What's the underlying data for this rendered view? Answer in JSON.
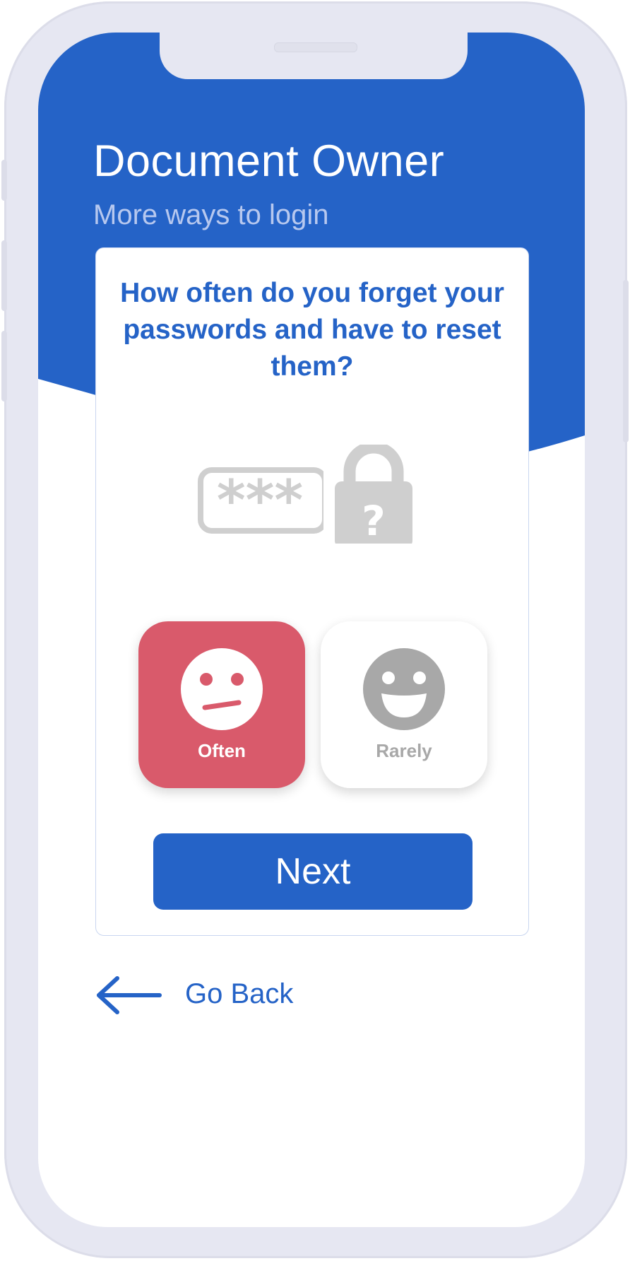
{
  "app": {
    "title": "Document Owner",
    "subtitle": "More ways to login"
  },
  "question": {
    "text": "How often do you forget your passwords and have to reset them?"
  },
  "illustration": {
    "masked_text": "***",
    "lock_symbol": "?",
    "icon": "password-lock-question-icon"
  },
  "choices": [
    {
      "label": "Often",
      "icon": "neutral-face-icon",
      "selected": true
    },
    {
      "label": "Rarely",
      "icon": "smiling-face-icon",
      "selected": false
    }
  ],
  "actions": {
    "next_label": "Next",
    "back_label": "Go Back",
    "back_icon": "arrow-left-icon"
  },
  "colors": {
    "primary": "#2563c7",
    "selected_choice": "#d95a6b",
    "subtitle": "#b7c8ef",
    "illustration_gray": "#cfcfcf",
    "frame": "#e6e7f2"
  }
}
